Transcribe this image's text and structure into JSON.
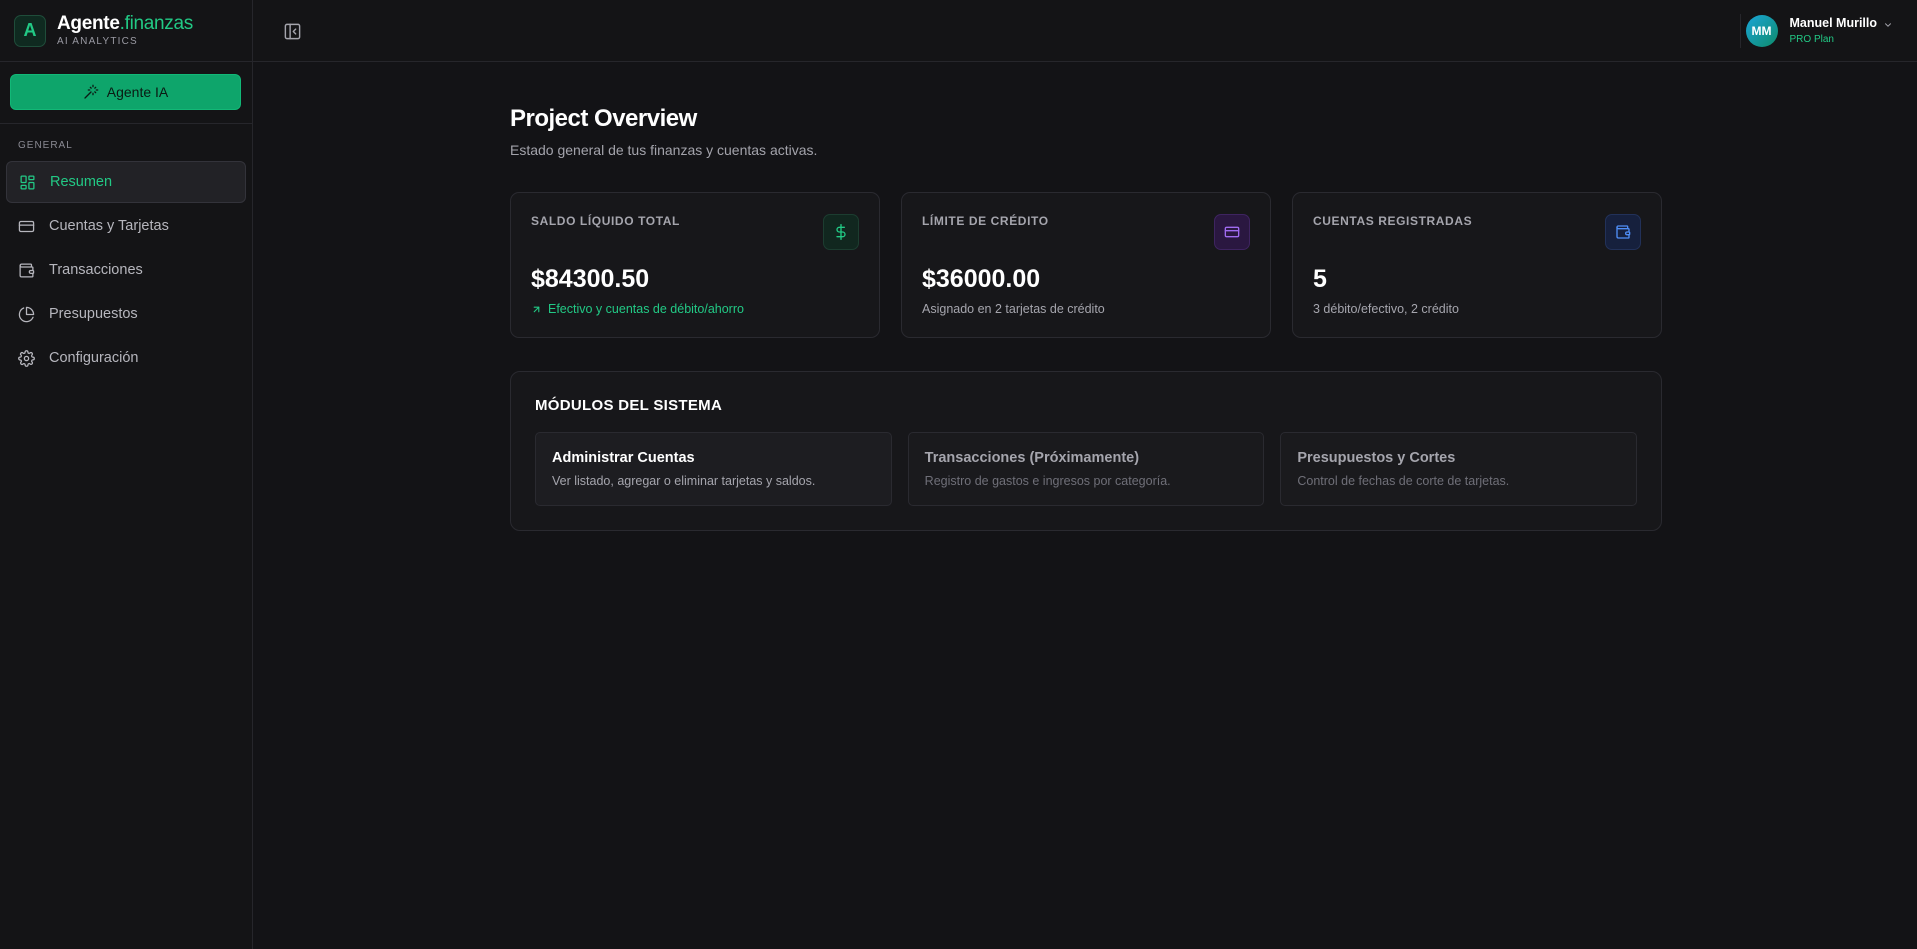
{
  "brand": {
    "logo_letter": "A",
    "name_primary": "Agente",
    "name_accent": ".finanzas",
    "subtitle": "AI ANALYTICS"
  },
  "sidebar": {
    "agent_button": "Agente IA",
    "section_title": "GENERAL",
    "items": [
      {
        "label": "Resumen",
        "icon": "dashboard-icon",
        "active": true
      },
      {
        "label": "Cuentas y Tarjetas",
        "icon": "credit-card-icon",
        "active": false
      },
      {
        "label": "Transacciones",
        "icon": "wallet-icon",
        "active": false
      },
      {
        "label": "Presupuestos",
        "icon": "pie-chart-icon",
        "active": false
      },
      {
        "label": "Configuración",
        "icon": "gear-icon",
        "active": false
      }
    ]
  },
  "header": {
    "user_initials": "MM",
    "user_name": "Manuel Murillo",
    "user_plan": "PRO Plan"
  },
  "main": {
    "title": "Project Overview",
    "subtitle": "Estado general de tus finanzas y cuentas activas.",
    "cards": [
      {
        "label": "SALDO LÍQUIDO TOTAL",
        "value": "$84300.50",
        "note": "Efectivo y cuentas de débito/ahorro",
        "icon": "dollar-icon",
        "accent": "#22c985"
      },
      {
        "label": "LÍMITE DE CRÉDITO",
        "value": "$36000.00",
        "note": "Asignado en 2 tarjetas de crédito",
        "icon": "credit-card-icon",
        "accent": "#a06bf0"
      },
      {
        "label": "CUENTAS REGISTRADAS",
        "value": "5",
        "note": "3 débito/efectivo, 2 crédito",
        "icon": "wallet-icon",
        "accent": "#4f8ef7"
      }
    ],
    "modules_title": "MÓDULOS DEL SISTEMA",
    "modules": [
      {
        "title": "Administrar Cuentas",
        "desc": "Ver listado, agregar o eliminar tarjetas y saldos.",
        "enabled": true
      },
      {
        "title": "Transacciones (Próximamente)",
        "desc": "Registro de gastos e ingresos por categoría.",
        "enabled": false
      },
      {
        "title": "Presupuestos y Cortes",
        "desc": "Control de fechas de corte de tarjetas.",
        "enabled": false
      }
    ]
  },
  "colors": {
    "accent": "#22c985",
    "background": "#131316",
    "button": "#0ea56b"
  }
}
